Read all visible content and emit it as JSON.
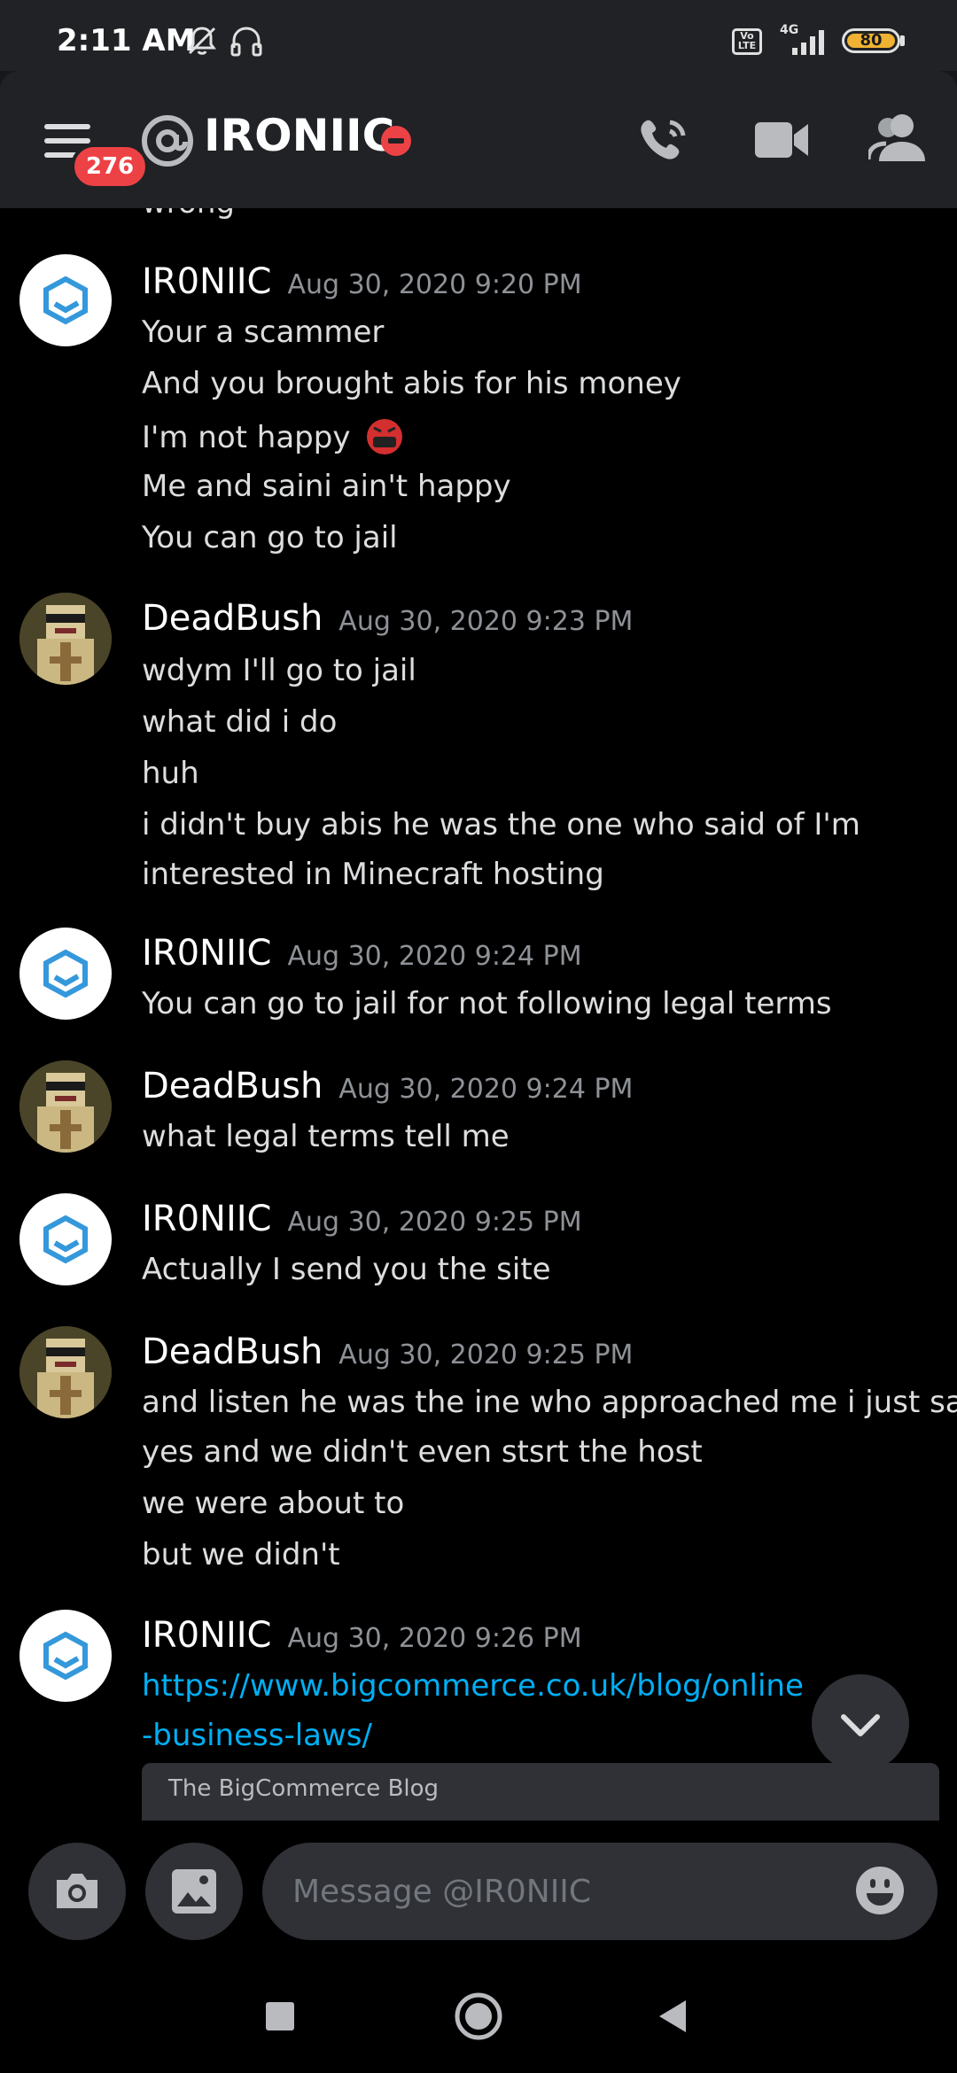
{
  "status_bar": {
    "time": "2:11 AM",
    "network": "4G",
    "volte": "Vo LTE",
    "battery": "80"
  },
  "header": {
    "unread_badge": "276",
    "title": "IRONIIC",
    "status_icon": "dnd-icon",
    "buttons": [
      "call-icon",
      "video-icon",
      "members-icon"
    ]
  },
  "messages": {
    "cut_text": "wrong",
    "groups": [
      {
        "author": "IR0NIIC",
        "time": "Aug 30, 2020 9:20 PM",
        "avatar": "cube-logo",
        "lines": [
          "Your a scammer",
          "And you brought abis for his money",
          "I'm not happy",
          "Me and saini ain't happy",
          "You can go to jail"
        ]
      },
      {
        "author": "DeadBush",
        "time": "Aug 30, 2020 9:23 PM",
        "avatar": "pixel-character",
        "lines": [
          "wdym I'll go to jail",
          "what did i do",
          "huh",
          "i didn't buy abis he was the one who said of I'm",
          "interested in Minecraft hosting"
        ]
      },
      {
        "author": "IR0NIIC",
        "time": "Aug 30, 2020 9:24 PM",
        "avatar": "cube-logo",
        "lines": [
          "You can go to jail for not following legal terms"
        ]
      },
      {
        "author": "DeadBush",
        "time": "Aug 30, 2020 9:24 PM",
        "avatar": "pixel-character",
        "lines": [
          "what legal terms tell me"
        ]
      },
      {
        "author": "IR0NIIC",
        "time": "Aug 30, 2020 9:25 PM",
        "avatar": "cube-logo",
        "lines": [
          "Actually I send you the site"
        ]
      },
      {
        "author": "DeadBush",
        "time": "Aug 30, 2020 9:25 PM",
        "avatar": "pixel-character",
        "lines": [
          "and listen he was the ine who approached me i just said",
          "yes and we didn't even stsrt the host",
          "we were about to",
          "but we didn't"
        ]
      },
      {
        "author": "IR0NIIC",
        "time": "Aug 30, 2020 9:26 PM",
        "avatar": "cube-logo",
        "lines": [
          "https://www.bigcommerce.co.uk/blog/online",
          "-business-laws/"
        ]
      }
    ],
    "embed_provider": "The BigCommerce Blog"
  },
  "composer": {
    "placeholder": "Message @IR0NIIC"
  },
  "colors": {
    "background": "#000000",
    "header": "#202225",
    "link": "#00aff4",
    "badge": "#ed4245",
    "timestamp": "#8e9297"
  }
}
